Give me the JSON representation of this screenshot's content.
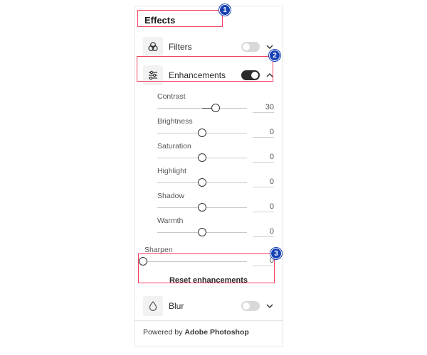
{
  "header": {
    "title": "Effects"
  },
  "filters": {
    "label": "Filters",
    "on": false
  },
  "enhancements": {
    "label": "Enhancements",
    "on": true,
    "expanded": true,
    "sliders": [
      {
        "id": "contrast",
        "label": "Contrast",
        "value": 30,
        "min": -100,
        "max": 100,
        "zero_centered": true
      },
      {
        "id": "brightness",
        "label": "Brightness",
        "value": 0,
        "min": -100,
        "max": 100,
        "zero_centered": true
      },
      {
        "id": "saturation",
        "label": "Saturation",
        "value": 0,
        "min": -100,
        "max": 100,
        "zero_centered": true
      },
      {
        "id": "highlight",
        "label": "Highlight",
        "value": 0,
        "min": -100,
        "max": 100,
        "zero_centered": true
      },
      {
        "id": "shadow",
        "label": "Shadow",
        "value": 0,
        "min": -100,
        "max": 100,
        "zero_centered": true
      },
      {
        "id": "warmth",
        "label": "Warmth",
        "value": 0,
        "min": -100,
        "max": 100,
        "zero_centered": true
      }
    ],
    "sharpen": {
      "label": "Sharpen",
      "value": 0,
      "min": 0,
      "max": 100
    },
    "reset_label": "Reset enhancements"
  },
  "blur": {
    "label": "Blur",
    "on": false
  },
  "footer": {
    "prefix": "Powered by ",
    "brand": "Adobe Photoshop"
  },
  "annotations": {
    "1": "1",
    "2": "2",
    "3": "3"
  }
}
